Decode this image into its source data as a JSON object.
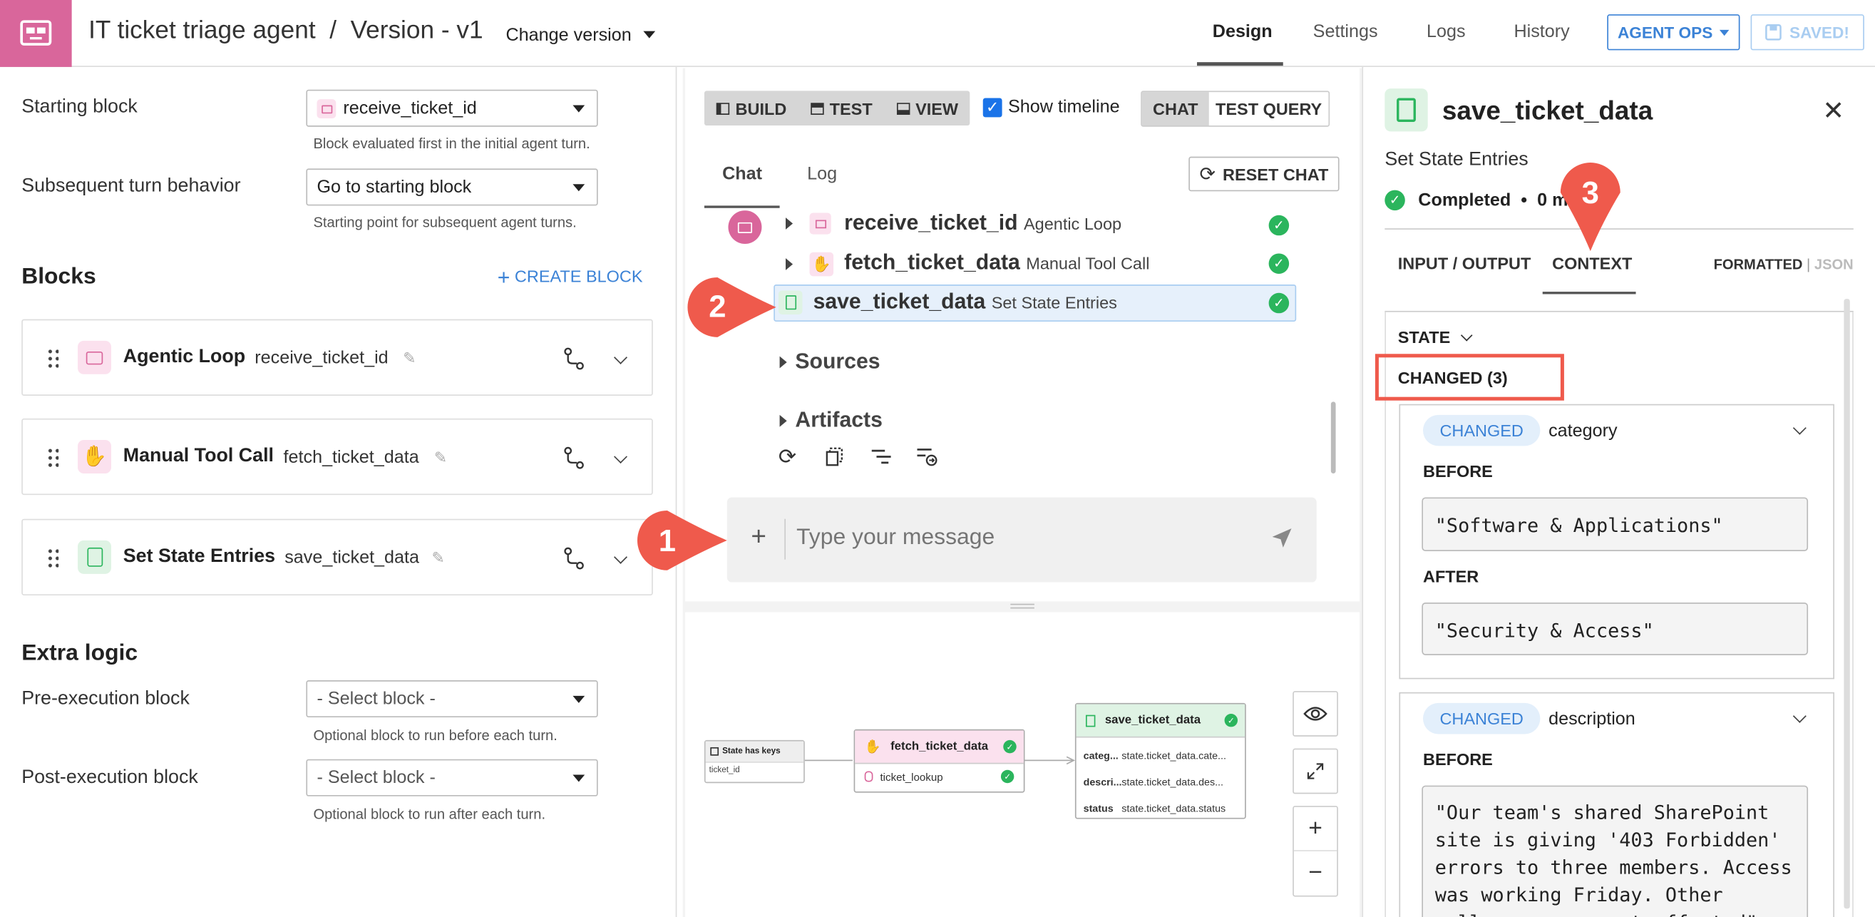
{
  "header": {
    "title": "IT ticket triage agent",
    "separator": "/",
    "version": "Version - v1",
    "change_version": "Change version",
    "nav": [
      "Design",
      "Settings",
      "Logs",
      "History"
    ],
    "agent_ops": "AGENT OPS",
    "saved": "SAVED!"
  },
  "left": {
    "starting_block_label": "Starting block",
    "starting_block_value": "receive_ticket_id",
    "starting_block_hint": "Block evaluated first in the initial agent turn.",
    "subsequent_label": "Subsequent turn behavior",
    "subsequent_value": "Go to starting block",
    "subsequent_hint": "Starting point for subsequent agent turns.",
    "blocks_title": "Blocks",
    "create_block": "CREATE BLOCK",
    "blocks": [
      {
        "type": "Agentic Loop",
        "name": "receive_ticket_id"
      },
      {
        "type": "Manual Tool Call",
        "name": "fetch_ticket_data"
      },
      {
        "type": "Set State Entries",
        "name": "save_ticket_data"
      }
    ],
    "extra_title": "Extra logic",
    "pre_label": "Pre-execution block",
    "pre_value": "- Select block -",
    "pre_hint": "Optional block to run before each turn.",
    "post_label": "Post-execution block",
    "post_value": "- Select block -",
    "post_hint": "Optional block to run after each turn."
  },
  "center": {
    "toolbar": {
      "build": "BUILD",
      "test": "TEST",
      "view": "VIEW",
      "show_timeline": "Show timeline",
      "chat": "CHAT",
      "test_query": "TEST QUERY"
    },
    "tabs": {
      "chat": "Chat",
      "log": "Log"
    },
    "reset_chat": "RESET CHAT",
    "timeline": [
      {
        "name": "receive_ticket_id",
        "type": "Agentic Loop"
      },
      {
        "name": "fetch_ticket_data",
        "type": "Manual Tool Call"
      },
      {
        "name": "save_ticket_data",
        "type": "Set State Entries"
      }
    ],
    "sources": "Sources",
    "artifacts": "Artifacts",
    "message_placeholder": "Type your message",
    "graph": {
      "state_node": {
        "title": "State has keys",
        "key": "ticket_id"
      },
      "fetch_node": {
        "title": "fetch_ticket_data",
        "tool": "ticket_lookup"
      },
      "save_node": {
        "title": "save_ticket_data",
        "rows": [
          {
            "k": "categ...",
            "v": "state.ticket_data.cate..."
          },
          {
            "k": "descri...",
            "v": "state.ticket_data.des..."
          },
          {
            "k": "status",
            "v": "state.ticket_data.status"
          }
        ]
      }
    },
    "zoom_plus": "+",
    "zoom_minus": "−"
  },
  "right": {
    "title": "save_ticket_data",
    "subtitle": "Set State Entries",
    "status": "Completed",
    "dot": "•",
    "duration": "0 m",
    "tab_io": "INPUT / OUTPUT",
    "tab_context": "CONTEXT",
    "formatted": "FORMATTED",
    "sep": "|",
    "json": "JSON",
    "state": "STATE",
    "changed": "CHANGED (3)",
    "changes": [
      {
        "badge": "CHANGED",
        "key": "category",
        "before_label": "BEFORE",
        "before": "\"Software & Applications\"",
        "after_label": "AFTER",
        "after": "\"Security & Access\""
      },
      {
        "badge": "CHANGED",
        "key": "description",
        "before_label": "BEFORE",
        "before": "\"Our team's shared SharePoint site is giving '403 Forbidden' errors to three members. Access was working Friday. Other colleagues are not affected\""
      }
    ]
  },
  "callouts": [
    "1",
    "2",
    "3"
  ],
  "colors": {
    "brand": "#d9669b",
    "accent": "#3b82d6",
    "success": "#2bb55d",
    "callout": "#ef5a4c"
  }
}
